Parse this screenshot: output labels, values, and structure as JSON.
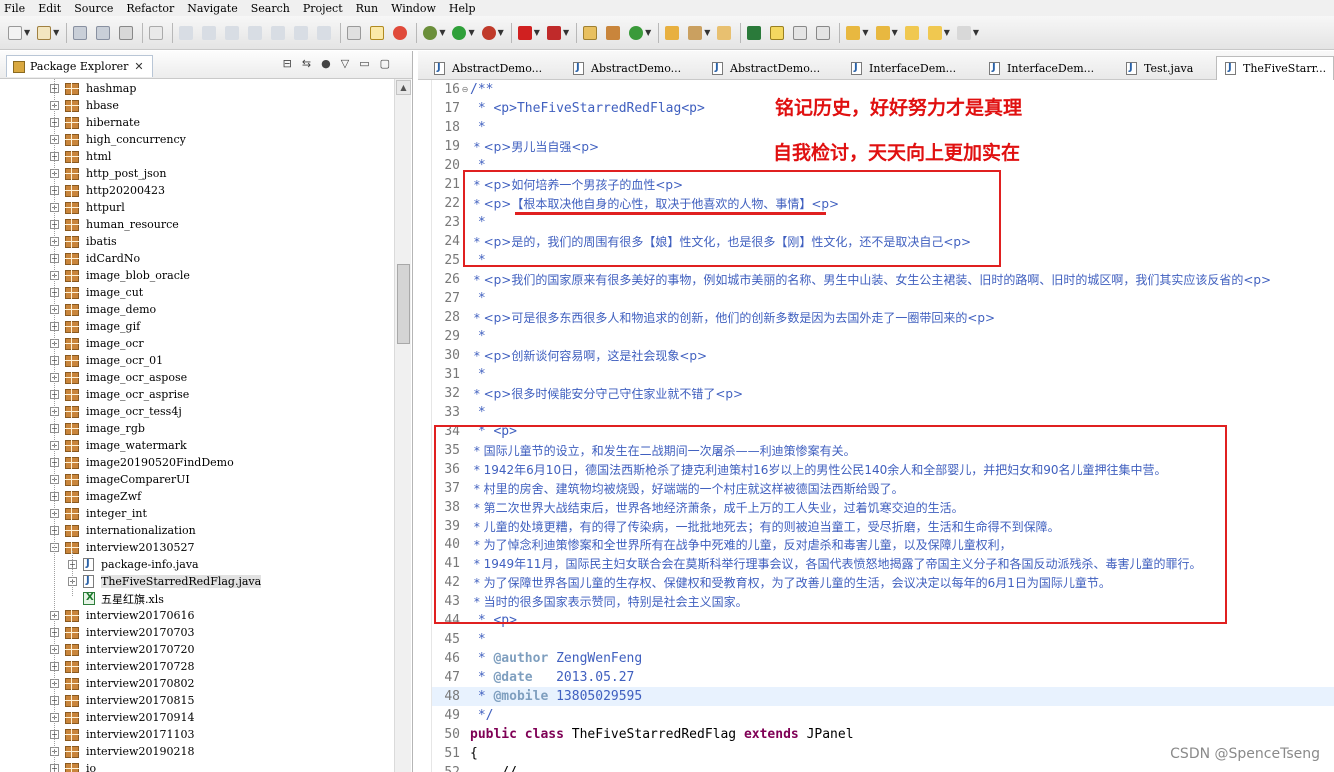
{
  "menu": [
    "File",
    "Edit",
    "Source",
    "Refactor",
    "Navigate",
    "Search",
    "Project",
    "Run",
    "Window",
    "Help"
  ],
  "package_explorer": {
    "title": "Package Explorer",
    "close": "✕",
    "items": [
      {
        "label": "hashmap",
        "type": "pkg"
      },
      {
        "label": "hbase",
        "type": "pkg"
      },
      {
        "label": "hibernate",
        "type": "pkg"
      },
      {
        "label": "high_concurrency",
        "type": "pkg"
      },
      {
        "label": "html",
        "type": "pkg"
      },
      {
        "label": "http_post_json",
        "type": "pkg"
      },
      {
        "label": "http20200423",
        "type": "pkg"
      },
      {
        "label": "httpurl",
        "type": "pkg"
      },
      {
        "label": "human_resource",
        "type": "pkg"
      },
      {
        "label": "ibatis",
        "type": "pkg"
      },
      {
        "label": "idCardNo",
        "type": "pkg"
      },
      {
        "label": "image_blob_oracle",
        "type": "pkg"
      },
      {
        "label": "image_cut",
        "type": "pkg"
      },
      {
        "label": "image_demo",
        "type": "pkg"
      },
      {
        "label": "image_gif",
        "type": "pkg"
      },
      {
        "label": "image_ocr",
        "type": "pkg"
      },
      {
        "label": "image_ocr_01",
        "type": "pkg"
      },
      {
        "label": "image_ocr_aspose",
        "type": "pkg"
      },
      {
        "label": "image_ocr_asprise",
        "type": "pkg"
      },
      {
        "label": "image_ocr_tess4j",
        "type": "pkg"
      },
      {
        "label": "image_rgb",
        "type": "pkg"
      },
      {
        "label": "image_watermark",
        "type": "pkg"
      },
      {
        "label": "image20190520FindDemo",
        "type": "pkg"
      },
      {
        "label": "imageComparerUI",
        "type": "pkg"
      },
      {
        "label": "imageZwf",
        "type": "pkg"
      },
      {
        "label": "integer_int",
        "type": "pkg"
      },
      {
        "label": "internationalization",
        "type": "pkg"
      },
      {
        "label": "interview20130527",
        "type": "pkg",
        "expanded": true
      },
      {
        "label": "package-info.java",
        "type": "java",
        "child": true
      },
      {
        "label": "TheFiveStarredRedFlag.java",
        "type": "java",
        "child": true,
        "selected": true
      },
      {
        "label": "五星红旗.xls",
        "type": "xls",
        "child": true,
        "leaf": true
      },
      {
        "label": "interview20170616",
        "type": "pkg"
      },
      {
        "label": "interview20170703",
        "type": "pkg"
      },
      {
        "label": "interview20170720",
        "type": "pkg"
      },
      {
        "label": "interview20170728",
        "type": "pkg"
      },
      {
        "label": "interview20170802",
        "type": "pkg"
      },
      {
        "label": "interview20170815",
        "type": "pkg"
      },
      {
        "label": "interview20170914",
        "type": "pkg"
      },
      {
        "label": "interview20171103",
        "type": "pkg"
      },
      {
        "label": "interview20190218",
        "type": "pkg"
      },
      {
        "label": "io",
        "type": "pkg"
      }
    ]
  },
  "editor": {
    "tabs": [
      {
        "label": "AbstractDemo..."
      },
      {
        "label": "AbstractDemo..."
      },
      {
        "label": "AbstractDemo..."
      },
      {
        "label": "InterfaceDem..."
      },
      {
        "label": "InterfaceDem..."
      },
      {
        "label": "Test.java"
      },
      {
        "label": "TheFiveStarr...",
        "active": true
      }
    ],
    "lines": [
      {
        "n": "16",
        "text": "/**",
        "fold": "⊖"
      },
      {
        "n": "17",
        "text": " * <p>TheFiveStarredRedFlag<p>"
      },
      {
        "n": "18",
        "text": " *"
      },
      {
        "n": "19",
        "text": " * <p>男儿当自强<p>"
      },
      {
        "n": "20",
        "text": " *"
      },
      {
        "n": "21",
        "text": " * <p>如何培养一个男孩子的血性<p>"
      },
      {
        "n": "22",
        "text": " * <p>【根本取决他自身的心性，取决于他喜欢的人物、事情】<p>"
      },
      {
        "n": "23",
        "text": " *"
      },
      {
        "n": "24",
        "text": " * <p>是的，我们的周围有很多【娘】性文化，也是很多【刚】性文化，还不是取决自己<p>"
      },
      {
        "n": "25",
        "text": " *"
      },
      {
        "n": "26",
        "text": " * <p>我们的国家原来有很多美好的事物，例如城市美丽的名称、男生中山装、女生公主裙装、旧时的路啊、旧时的城区啊，我们其实应该反省的<p>"
      },
      {
        "n": "27",
        "text": " *"
      },
      {
        "n": "28",
        "text": " * <p>可是很多东西很多人和物追求的创新，他们的创新多数是因为去国外走了一圈带回来的<p>"
      },
      {
        "n": "29",
        "text": " *"
      },
      {
        "n": "30",
        "text": " * <p>创新谈何容易啊，这是社会现象<p>"
      },
      {
        "n": "31",
        "text": " *"
      },
      {
        "n": "32",
        "text": " * <p>很多时候能安分守己守住家业就不错了<p>"
      },
      {
        "n": "33",
        "text": " *"
      },
      {
        "n": "34",
        "text": " * <p>"
      },
      {
        "n": "35",
        "text": " * 国际儿童节的设立，和发生在二战期间一次屠杀——利迪策惨案有关。"
      },
      {
        "n": "36",
        "text": " * 1942年6月10日，德国法西斯枪杀了捷克利迪策村16岁以上的男性公民140余人和全部婴儿，并把妇女和90名儿童押往集中营。"
      },
      {
        "n": "37",
        "text": " * 村里的房舍、建筑物均被烧毁，好端端的一个村庄就这样被德国法西斯给毁了。"
      },
      {
        "n": "38",
        "text": " * 第二次世界大战结束后，世界各地经济萧条，成千上万的工人失业，过着饥寒交迫的生活。"
      },
      {
        "n": "39",
        "text": " * 儿童的处境更糟，有的得了传染病，一批批地死去；有的则被迫当童工，受尽折磨，生活和生命得不到保障。"
      },
      {
        "n": "40",
        "text": " * 为了悼念利迪策惨案和全世界所有在战争中死难的儿童，反对虐杀和毒害儿童，以及保障儿童权利，"
      },
      {
        "n": "41",
        "text": " * 1949年11月，国际民主妇女联合会在莫斯科举行理事会议，各国代表愤怒地揭露了帝国主义分子和各国反动派残杀、毒害儿童的罪行。"
      },
      {
        "n": "42",
        "text": " * 为了保障世界各国儿童的生存权、保健权和受教育权，为了改善儿童的生活，会议决定以每年的6月1日为国际儿童节。"
      },
      {
        "n": "43",
        "text": " * 当时的很多国家表示赞同，特别是社会主义国家。"
      },
      {
        "n": "44",
        "text": " * <p>"
      },
      {
        "n": "45",
        "text": " *"
      },
      {
        "n": "46",
        "text": " * @author ZengWenFeng"
      },
      {
        "n": "47",
        "text": " * @date   2013.05.27"
      },
      {
        "n": "48",
        "text": " * @mobile 13805029595"
      },
      {
        "n": "49",
        "text": " */"
      },
      {
        "n": "50",
        "text": "public class TheFiveStarredRedFlag extends JPanel"
      },
      {
        "n": "51",
        "text": "{"
      },
      {
        "n": "52",
        "text": "    //"
      }
    ]
  },
  "annotations": {
    "note1": "铭记历史，好好努力才是真理",
    "note2": "自我检讨，天天向上更加实在"
  },
  "watermark": "CSDN @SpenceTseng",
  "colors": {
    "javadoc": "#3f5fbf",
    "keyword": "#7f0055",
    "annotation_red": "#e02020",
    "current_line": "#e8f2fe"
  }
}
